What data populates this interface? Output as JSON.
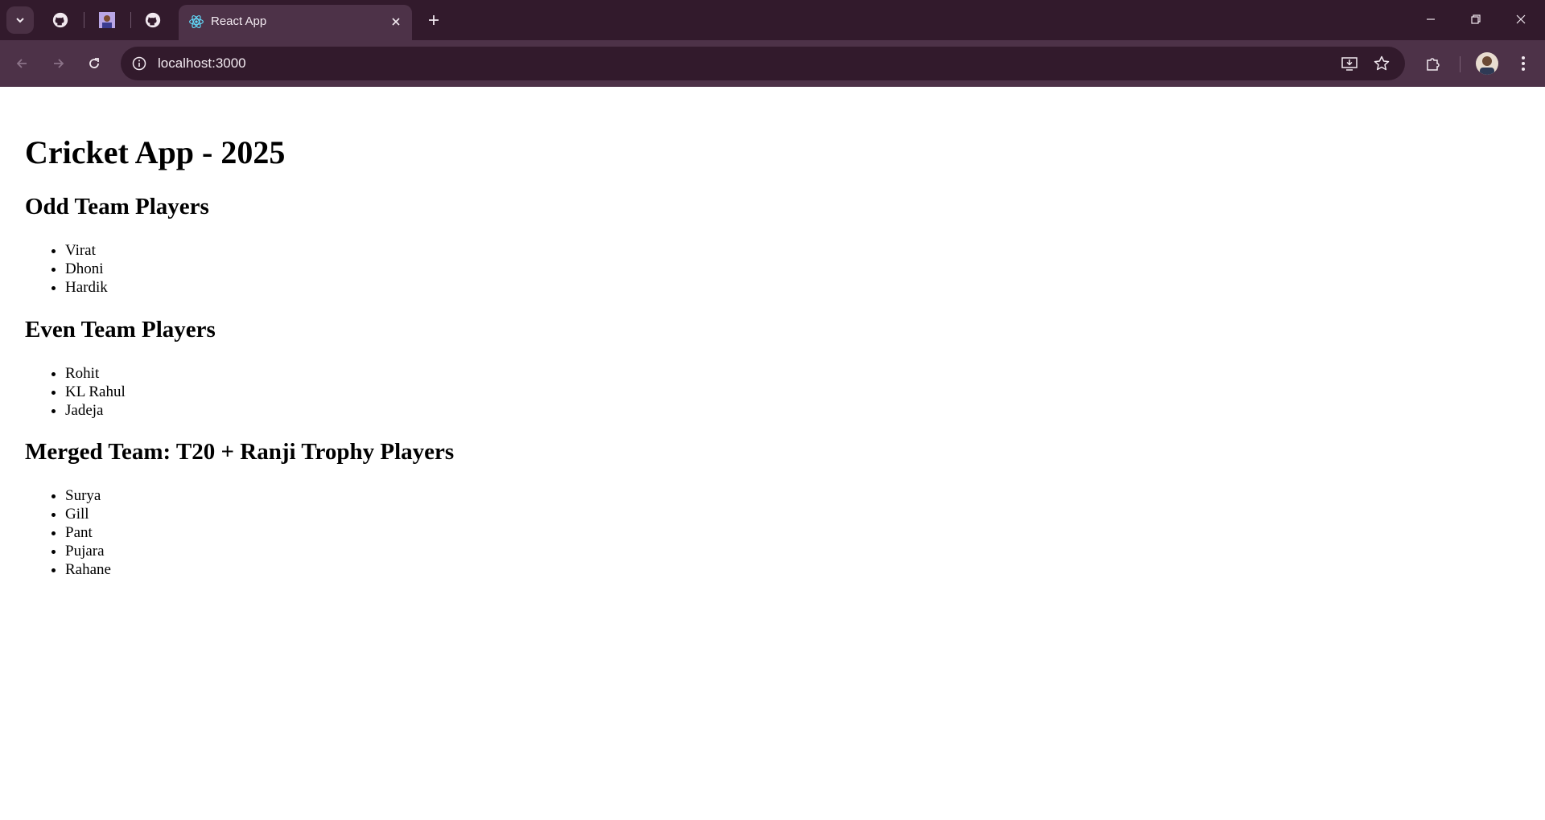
{
  "browser": {
    "active_tab_title": "React App",
    "url": "localhost:3000"
  },
  "page": {
    "title": "Cricket App - 2025",
    "sections": [
      {
        "heading": "Odd Team Players",
        "players": [
          "Virat",
          "Dhoni",
          "Hardik"
        ]
      },
      {
        "heading": "Even Team Players",
        "players": [
          "Rohit",
          "KL Rahul",
          "Jadeja"
        ]
      },
      {
        "heading": "Merged Team: T20 + Ranji Trophy Players",
        "players": [
          "Surya",
          "Gill",
          "Pant",
          "Pujara",
          "Rahane"
        ]
      }
    ]
  },
  "colors": {
    "tabstrip": "#321a2c",
    "toolbar": "#4d3248",
    "page_background": "#ffffff"
  }
}
